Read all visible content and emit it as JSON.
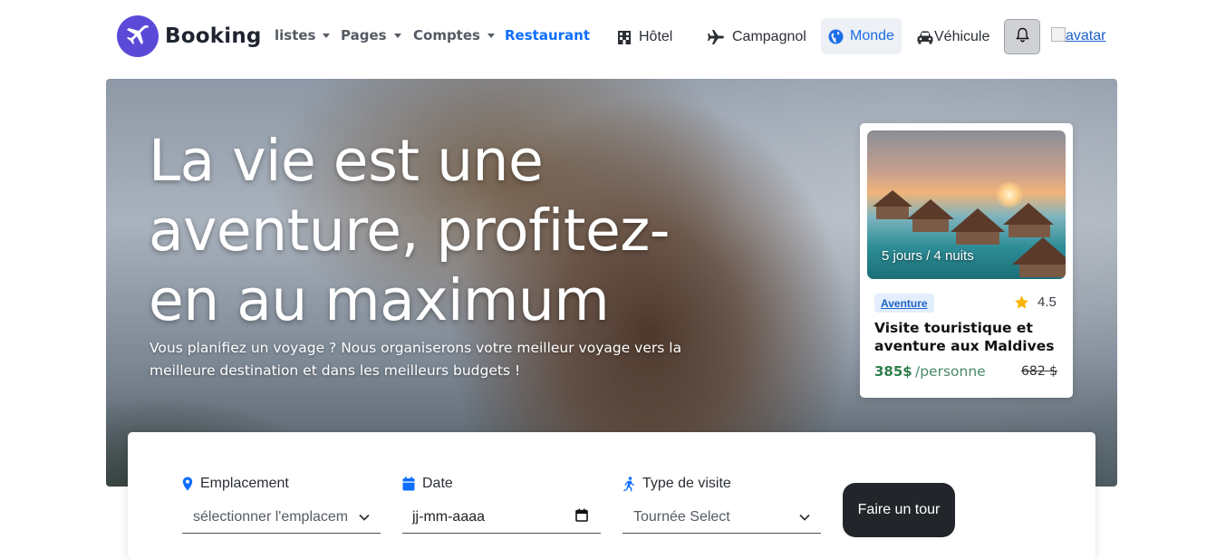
{
  "brand": {
    "name": "Booking",
    "logo_icon": "plane-icon",
    "logo_color": "#5b4ad8"
  },
  "nav": {
    "dropdowns": [
      {
        "label": "listes"
      },
      {
        "label": "Pages"
      },
      {
        "label": "Comptes"
      }
    ],
    "active_link": "Restaurant",
    "categories": [
      {
        "label": "Hôtel",
        "icon": "hotel-icon"
      },
      {
        "label": "Campagnol",
        "icon": "plane-icon"
      },
      {
        "label": "Monde",
        "icon": "globe-icon"
      },
      {
        "label": "Véhicule",
        "icon": "car-icon"
      }
    ],
    "notification_icon": "bell-icon",
    "avatar_alt": "avatar"
  },
  "hero": {
    "title": "La vie est une aventure, profitez-en au maximum",
    "subtitle": "Vous planifiez un voyage ? Nous organiserons votre meilleur voyage vers la meilleure destination et dans les meilleurs budgets !"
  },
  "offer": {
    "duration": "5 jours / 4 nuits",
    "badge": "Aventure",
    "rating": "4.5",
    "title": "Visite touristique et aventure aux Maldives",
    "price": "385$",
    "per": "/personne",
    "old_price": "682 $"
  },
  "search": {
    "location": {
      "label": "Emplacement",
      "value": "sélectionner l'emplacement",
      "icon": "map-pin-icon"
    },
    "date": {
      "label": "Date",
      "value": "jj-mm-aaaa",
      "icon": "calendar-icon"
    },
    "visit_type": {
      "label": "Type de visite",
      "value": "Tournée Select",
      "icon": "walking-icon"
    },
    "submit_label": "Faire un tour"
  },
  "colors": {
    "accent": "#0d6efd",
    "price_green": "#2e7d4b",
    "dark_button": "#22262b"
  }
}
